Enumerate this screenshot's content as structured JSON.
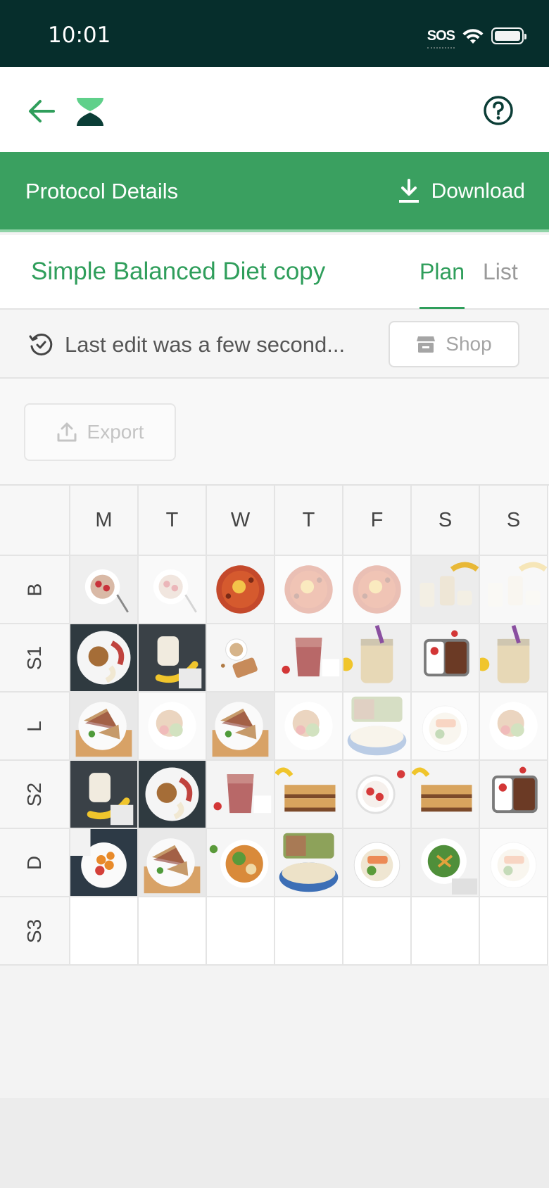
{
  "status_bar": {
    "time": "10:01",
    "sos": "SOS"
  },
  "header": {
    "back_icon": "arrow-left-icon",
    "logo_icon": "hourglass-logo-icon",
    "help_icon": "help-circle-icon"
  },
  "protocol_bar": {
    "title": "Protocol Details",
    "download_label": "Download"
  },
  "diet": {
    "title": "Simple Balanced Diet copy"
  },
  "tabs": [
    {
      "label": "Plan",
      "active": true
    },
    {
      "label": "List",
      "active": false
    }
  ],
  "edit_info": {
    "text": "Last edit was a few second...",
    "shop_label": "Shop"
  },
  "export_label": "Export",
  "grid": {
    "days": [
      "M",
      "T",
      "W",
      "T",
      "F",
      "S",
      "S"
    ],
    "rows": [
      {
        "label": "B",
        "meals": [
          {
            "kind": "bowl-berries",
            "faded": false
          },
          {
            "kind": "bowl-berries",
            "faded": true
          },
          {
            "kind": "shakshuka",
            "faded": false
          },
          {
            "kind": "shakshuka",
            "faded": true
          },
          {
            "kind": "shakshuka",
            "faded": true
          },
          {
            "kind": "jars-banana",
            "faded": false
          },
          {
            "kind": "jars-banana",
            "faded": true
          }
        ]
      },
      {
        "label": "S1",
        "meals": [
          {
            "kind": "apple-dip",
            "faded": false
          },
          {
            "kind": "jar-banana",
            "faded": false
          },
          {
            "kind": "granola-bowl",
            "faded": false
          },
          {
            "kind": "smoothie",
            "faded": false
          },
          {
            "kind": "jar-straw",
            "faded": false
          },
          {
            "kind": "bento",
            "faded": false
          },
          {
            "kind": "jar-straw",
            "faded": false
          }
        ]
      },
      {
        "label": "L",
        "meals": [
          {
            "kind": "sandwich",
            "faded": false
          },
          {
            "kind": "salad-plate",
            "faded": true
          },
          {
            "kind": "sandwich",
            "faded": false
          },
          {
            "kind": "salad-plate",
            "faded": true
          },
          {
            "kind": "pasta-salad",
            "faded": true
          },
          {
            "kind": "salmon-bowl",
            "faded": true
          },
          {
            "kind": "salad-plate",
            "faded": true
          }
        ]
      },
      {
        "label": "S2",
        "meals": [
          {
            "kind": "jar-banana",
            "faded": false
          },
          {
            "kind": "apple-dip",
            "faded": false
          },
          {
            "kind": "smoothie",
            "faded": false
          },
          {
            "kind": "toast-stack",
            "faded": false
          },
          {
            "kind": "yogurt-berries",
            "faded": false
          },
          {
            "kind": "toast-stack",
            "faded": false
          },
          {
            "kind": "bento",
            "faded": false
          }
        ]
      },
      {
        "label": "D",
        "meals": [
          {
            "kind": "sweet-potato",
            "faded": false
          },
          {
            "kind": "sandwich",
            "faded": false
          },
          {
            "kind": "buddha-bowl",
            "faded": false
          },
          {
            "kind": "pasta-salad",
            "faded": false
          },
          {
            "kind": "salmon-bowl",
            "faded": false
          },
          {
            "kind": "green-plate",
            "faded": false
          },
          {
            "kind": "salmon-bowl",
            "faded": true
          }
        ]
      },
      {
        "label": "S3",
        "meals": [
          null,
          null,
          null,
          null,
          null,
          null,
          null
        ]
      }
    ]
  },
  "colors": {
    "brand_green": "#3aa060",
    "text_green": "#2f9e5b",
    "status_bar": "#062e2c"
  }
}
